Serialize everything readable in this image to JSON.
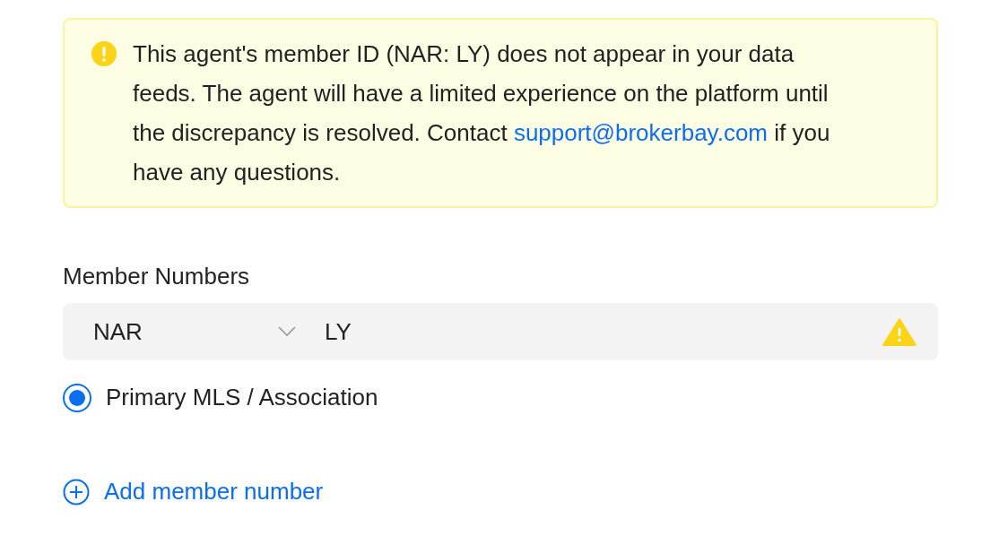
{
  "alert": {
    "message_before": "This agent's member ID (NAR: LY) does not appear in your data feeds. The agent will have a limited experience on the platform until the discrepancy is resolved. Contact ",
    "link": "support@brokerbay.com",
    "message_after": " if you have any questions."
  },
  "member_numbers": {
    "label": "Member Numbers",
    "rows": [
      {
        "association": "NAR",
        "number": "LY",
        "warning": true,
        "primary": {
          "label": "Primary MLS / Association",
          "checked": true
        }
      }
    ]
  },
  "add_button": "Add member number"
}
